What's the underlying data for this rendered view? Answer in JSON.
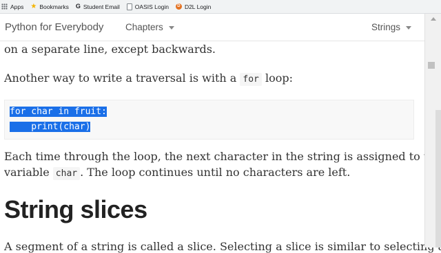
{
  "bookmarks_bar": {
    "items": [
      {
        "label": "Apps",
        "icon": "apps-grid-icon"
      },
      {
        "label": "Bookmarks",
        "icon": "star-icon"
      },
      {
        "label": "Student Email",
        "icon": "google-icon"
      },
      {
        "label": "OASIS Login",
        "icon": "page-icon"
      },
      {
        "label": "D2L Login",
        "icon": "d2l-icon"
      }
    ]
  },
  "header": {
    "site_title": "Python for Everybody",
    "chapters_label": "Chapters",
    "current_section_label": "Strings"
  },
  "content": {
    "line_partial": "on a separate line, except backwards.",
    "para1_before": "Another way to write a traversal is with a ",
    "para1_code": "for",
    "para1_after": " loop:",
    "code_line1": "for char in fruit:",
    "code_line2": "    print(char)",
    "para2_line1": "Each time through the loop, the next character in the string is assigned to the",
    "para2_line2_before": "variable ",
    "para2_line2_code": "char",
    "para2_line2_after": ". The loop continues until no characters are left.",
    "heading": "String slices",
    "para3_partial": "A segment of a string is called a slice. Selecting a slice is similar to selecting a"
  }
}
